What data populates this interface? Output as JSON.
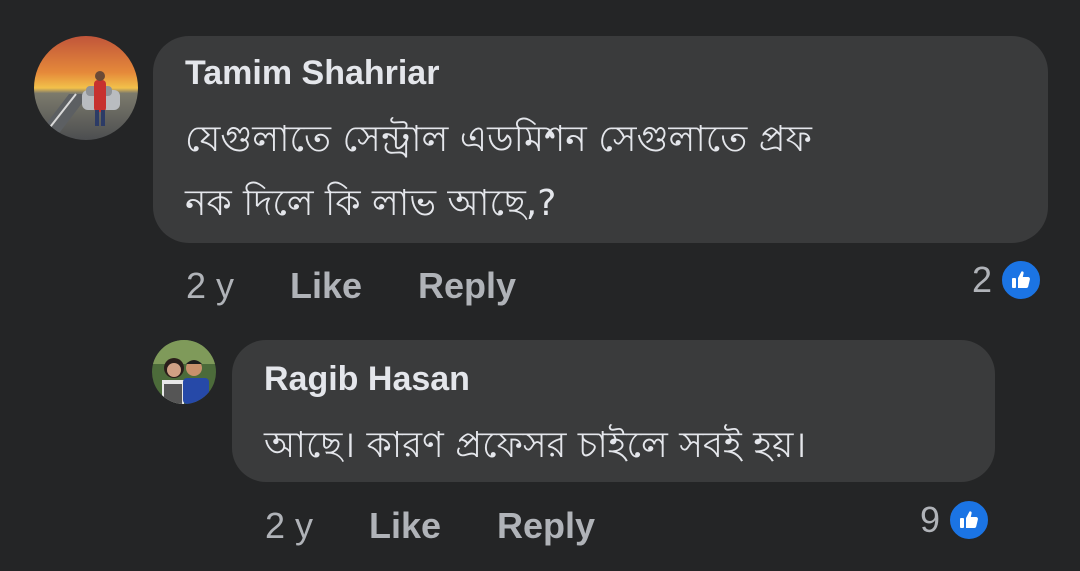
{
  "comments": [
    {
      "author": "Tamim Shahriar",
      "text_line1": "যেগুলাতে সেন্ট্রাল এডমিশন সেগুলাতে প্রফ",
      "text_line2": "নক দিলে কি লাভ আছে,?",
      "time": "2 y",
      "like_label": "Like",
      "reply_label": "Reply",
      "reaction_count": "2",
      "reaction_icon": "like-thumb-icon"
    },
    {
      "author": "Ragib Hasan",
      "text_line1": "আছে। কারণ প্রফেসর চাইলে সবই হয়।",
      "time": "2 y",
      "like_label": "Like",
      "reply_label": "Reply",
      "reaction_count": "9",
      "reaction_icon": "like-thumb-icon"
    }
  ],
  "colors": {
    "background": "#242526",
    "bubble": "#3a3b3c",
    "primary_text": "#e4e6eb",
    "secondary_text": "#b0b3b8",
    "like_blue": "#1b74e4"
  }
}
